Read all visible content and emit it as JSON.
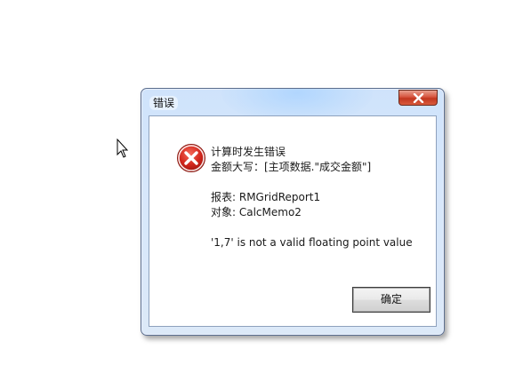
{
  "dialog": {
    "title": "错误",
    "close_icon": "close-icon",
    "error_icon": "error-icon",
    "message": {
      "line1": "计算时发生错误",
      "line2": "金额大写：[主项数据.\"成交金额\"]",
      "line3": "报表: RMGridReport1",
      "line4": "对象: CalcMemo2",
      "line5": "'1,7' is not a valid floating point value"
    },
    "ok_label": "确定"
  },
  "colors": {
    "title_gradient": "#cfe3fb",
    "close_red": "#c2361f",
    "error_red": "#c3201b"
  }
}
